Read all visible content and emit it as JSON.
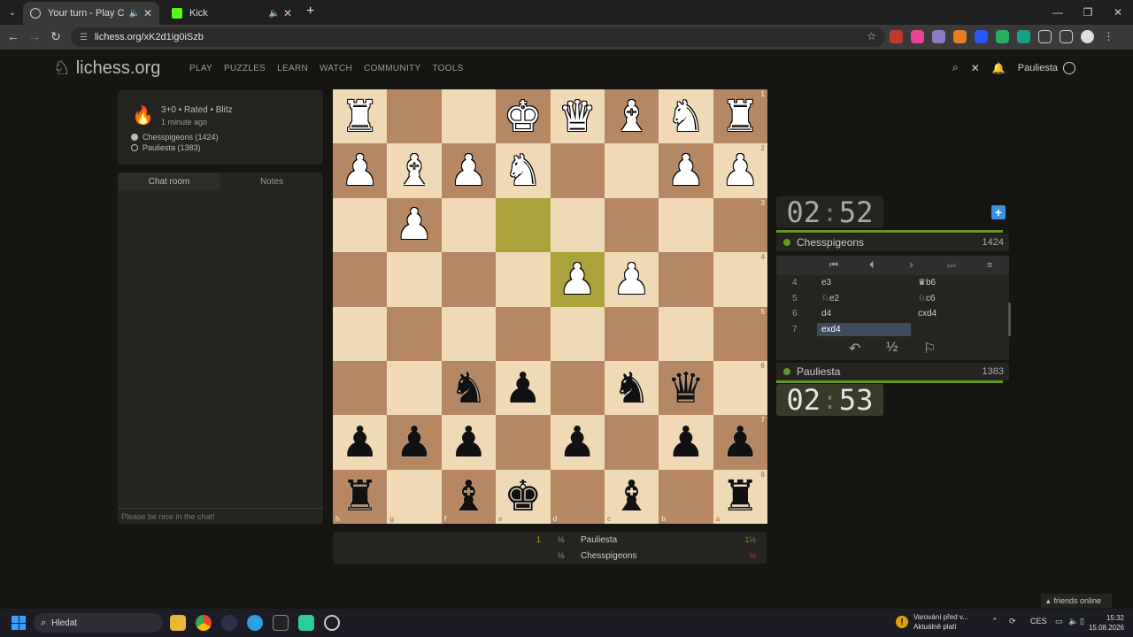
{
  "browser": {
    "tabs": [
      {
        "title": "Your turn - Play Chesspigeons",
        "active": true
      },
      {
        "title": "Kick",
        "active": false
      }
    ],
    "url": "lichess.org/xK2d1ig0iSzb"
  },
  "site": {
    "logo": "lichess.org",
    "nav": [
      "PLAY",
      "PUZZLES",
      "LEARN",
      "WATCH",
      "COMMUNITY",
      "TOOLS"
    ],
    "username": "Pauliesta"
  },
  "game_info": {
    "setup": "3+0 • Rated • Blitz",
    "when": "1 minute ago",
    "players": [
      "Chesspigeons (1424)",
      "Pauliesta (1383)"
    ]
  },
  "chat": {
    "tabs": [
      "Chat room",
      "Notes"
    ],
    "placeholder": "Please be nice in the chat!"
  },
  "board": {
    "ranks": [
      "1",
      "2",
      "3",
      "4",
      "5",
      "6",
      "7",
      "8"
    ],
    "files": [
      "h",
      "g",
      "f",
      "e",
      "d",
      "c",
      "b",
      "a"
    ],
    "rows": [
      [
        "wR",
        "",
        "",
        "wK",
        "wQ",
        "wB",
        "wN",
        "wR"
      ],
      [
        "wP",
        "wB",
        "wP",
        "wN",
        "",
        "",
        "wP",
        "wP"
      ],
      [
        "",
        "wP",
        "",
        "",
        "",
        "",
        "",
        ""
      ],
      [
        "",
        "",
        "",
        "",
        "wP",
        "wP",
        "",
        ""
      ],
      [
        "",
        "",
        "",
        "",
        "",
        "",
        "",
        ""
      ],
      [
        "",
        "",
        "bN",
        "bP",
        "",
        "bN",
        "bQ",
        ""
      ],
      [
        "bP",
        "bP",
        "bP",
        "",
        "bP",
        "",
        "bP",
        "bP"
      ],
      [
        "bR",
        "",
        "bB",
        "bK",
        "",
        "bB",
        "",
        "bR"
      ]
    ]
  },
  "score": {
    "rows": [
      {
        "pts": "1",
        "half": "½",
        "name": "Pauliesta",
        "result": "1½"
      },
      {
        "pts": "",
        "half": "½",
        "name": "Chesspigeons",
        "result": "½"
      }
    ]
  },
  "opponent": {
    "clock_min": "02",
    "clock_sec": "52",
    "name": "Chesspigeons",
    "rating": "1424"
  },
  "me": {
    "clock_min": "02",
    "clock_sec": "53",
    "name": "Pauliesta",
    "rating": "1383"
  },
  "moves": [
    {
      "n": "4",
      "w": "e3",
      "b": "♛b6"
    },
    {
      "n": "5",
      "w": "♘e2",
      "b": "♘c6"
    },
    {
      "n": "6",
      "w": "d4",
      "b": "cxd4"
    },
    {
      "n": "7",
      "w": "exd4",
      "b": ""
    }
  ],
  "actions": {
    "draw": "½"
  },
  "friends": "friends online",
  "taskbar": {
    "search": "Hledat",
    "warning_line1": "Varování před v...",
    "warning_line2": "Aktuálně platí",
    "lang": "CES",
    "time": "15:32",
    "date": "15.08.2026"
  },
  "colors": {
    "accent": "#629924",
    "light_square": "#f0d9b5",
    "dark_square": "#b58863",
    "highlight": "#aaa23a"
  }
}
